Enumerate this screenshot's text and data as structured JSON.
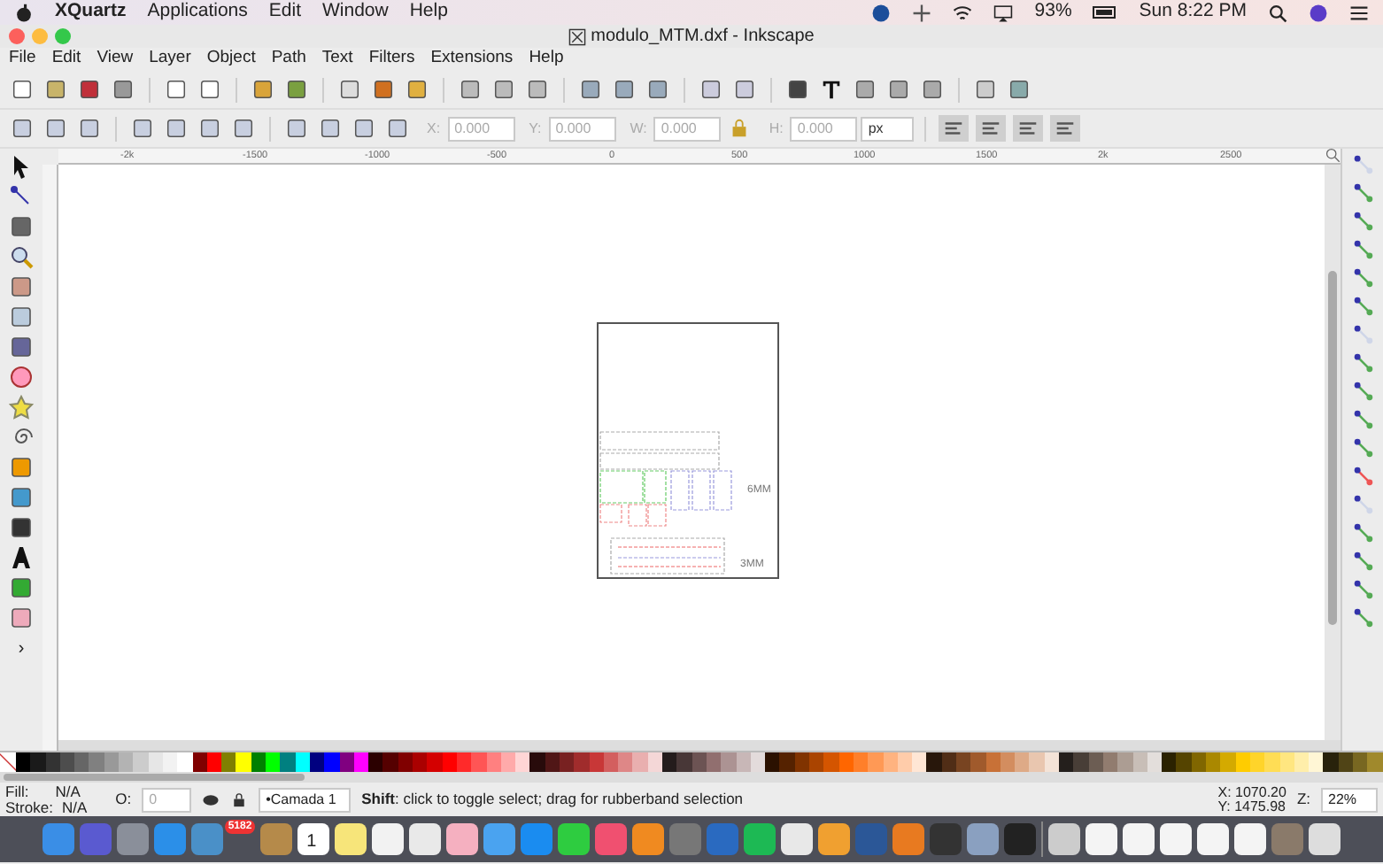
{
  "mac_menubar": {
    "app": "XQuartz",
    "menus": [
      "Applications",
      "Edit",
      "Window",
      "Help"
    ],
    "battery": "93%",
    "clock": "Sun 8:22 PM"
  },
  "window": {
    "title": "modulo_MTM.dxf - Inkscape"
  },
  "menu": [
    "File",
    "Edit",
    "View",
    "Layer",
    "Object",
    "Path",
    "Text",
    "Filters",
    "Extensions",
    "Help"
  ],
  "select_toolbar": {
    "fields": [
      {
        "label": "X:",
        "value": "0.000"
      },
      {
        "label": "Y:",
        "value": "0.000"
      },
      {
        "label": "W:",
        "value": "0.000"
      },
      {
        "label": "H:",
        "value": "0.000"
      }
    ],
    "unit": "px"
  },
  "toolbox": {
    "more": "›"
  },
  "ruler": {
    "labels": [
      "-2k",
      "-1500",
      "-1000",
      "-500",
      "0",
      "500",
      "1000",
      "1500",
      "2k",
      "2500"
    ]
  },
  "canvas": {
    "labels": [
      "6MM",
      "3MM"
    ]
  },
  "palette": [
    {
      "color": "#000000"
    },
    {
      "color": "#1a1a1a"
    },
    {
      "color": "#333333"
    },
    {
      "color": "#4d4d4d"
    },
    {
      "color": "#666666"
    },
    {
      "color": "#808080"
    },
    {
      "color": "#999999"
    },
    {
      "color": "#b3b3b3"
    },
    {
      "color": "#cccccc"
    },
    {
      "color": "#e6e6e6"
    },
    {
      "color": "#f2f2f2"
    },
    {
      "color": "#ffffff"
    },
    {
      "color": "#800000"
    },
    {
      "color": "#ff0000"
    },
    {
      "color": "#808000"
    },
    {
      "color": "#ffff00"
    },
    {
      "color": "#008000"
    },
    {
      "color": "#00ff00"
    },
    {
      "color": "#008080"
    },
    {
      "color": "#00ffff"
    },
    {
      "color": "#000080"
    },
    {
      "color": "#0000ff"
    },
    {
      "color": "#800080"
    },
    {
      "color": "#ff00ff"
    },
    {
      "color": "#2b0000"
    },
    {
      "color": "#550000"
    },
    {
      "color": "#800000"
    },
    {
      "color": "#aa0000"
    },
    {
      "color": "#d40000"
    },
    {
      "color": "#ff0000"
    },
    {
      "color": "#ff2a2a"
    },
    {
      "color": "#ff5555"
    },
    {
      "color": "#ff8080"
    },
    {
      "color": "#ffaaaa"
    },
    {
      "color": "#ffd5d5"
    },
    {
      "color": "#280b0b"
    },
    {
      "color": "#501616"
    },
    {
      "color": "#782121"
    },
    {
      "color": "#a02c2c"
    },
    {
      "color": "#c83737"
    },
    {
      "color": "#d35f5f"
    },
    {
      "color": "#de8787"
    },
    {
      "color": "#e9afaf"
    },
    {
      "color": "#f4d7d7"
    },
    {
      "color": "#241c1c"
    },
    {
      "color": "#483737"
    },
    {
      "color": "#6c5353"
    },
    {
      "color": "#916f6f"
    },
    {
      "color": "#ac9393"
    },
    {
      "color": "#c8b7b7"
    },
    {
      "color": "#e3dbdb"
    },
    {
      "color": "#2b1100"
    },
    {
      "color": "#552200"
    },
    {
      "color": "#803300"
    },
    {
      "color": "#aa4400"
    },
    {
      "color": "#d45500"
    },
    {
      "color": "#ff6600"
    },
    {
      "color": "#ff7f2a"
    },
    {
      "color": "#ff9955"
    },
    {
      "color": "#ffb380"
    },
    {
      "color": "#ffccaa"
    },
    {
      "color": "#ffe6d5"
    },
    {
      "color": "#28170b"
    },
    {
      "color": "#502d16"
    },
    {
      "color": "#784421"
    },
    {
      "color": "#a05a2c"
    },
    {
      "color": "#c87137"
    },
    {
      "color": "#d38d5f"
    },
    {
      "color": "#deaa87"
    },
    {
      "color": "#e9c6af"
    },
    {
      "color": "#f4e3d7"
    },
    {
      "color": "#241f1c"
    },
    {
      "color": "#483e37"
    },
    {
      "color": "#6c5d53"
    },
    {
      "color": "#917c6f"
    },
    {
      "color": "#ac9d93"
    },
    {
      "color": "#c8beb7"
    },
    {
      "color": "#e3dedb"
    },
    {
      "color": "#2b2200"
    },
    {
      "color": "#554400"
    },
    {
      "color": "#806600"
    },
    {
      "color": "#aa8800"
    },
    {
      "color": "#d4aa00"
    },
    {
      "color": "#ffcc00"
    },
    {
      "color": "#ffd42a"
    },
    {
      "color": "#ffdd55"
    },
    {
      "color": "#ffe680"
    },
    {
      "color": "#ffeeaa"
    },
    {
      "color": "#fff6d5"
    },
    {
      "color": "#28220b"
    },
    {
      "color": "#504416"
    },
    {
      "color": "#786721"
    },
    {
      "color": "#a0892c"
    }
  ],
  "status": {
    "fill_label": "Fill:",
    "fill_value": "N/A",
    "stroke_label": "Stroke:",
    "stroke_value": "N/A",
    "opacity_label": "O:",
    "opacity_value": "0",
    "layer": "•Camada 1",
    "message": "**Shift**: click to toggle select; drag for rubberband selection",
    "x": "X: 1070.20",
    "y": "Y: 1475.98",
    "zoom_label": "Z:",
    "zoom": "22%"
  },
  "dock": {
    "badge": "5182",
    "calendar_day": "1"
  }
}
